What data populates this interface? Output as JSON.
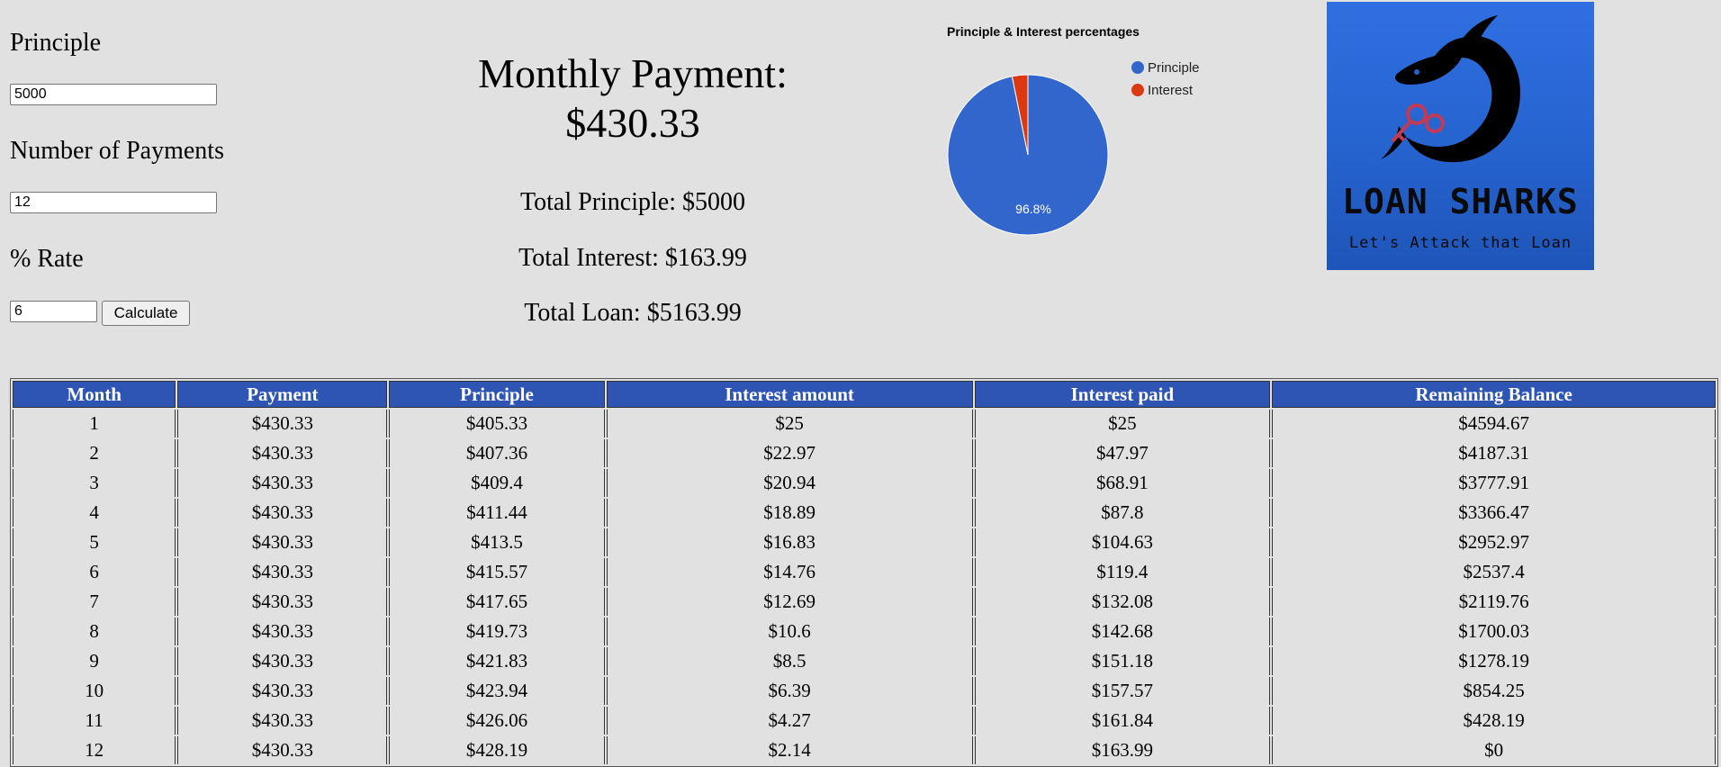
{
  "form": {
    "principle_label": "Principle",
    "principle_value": "5000",
    "payments_label": "Number of Payments",
    "payments_value": "12",
    "rate_label": "% Rate",
    "rate_value": "6",
    "calculate_label": "Calculate"
  },
  "summary": {
    "monthly_label": "Monthly Payment:",
    "monthly_value": "$430.33",
    "total_principle": "Total Principle: $5000",
    "total_interest": "Total Interest: $163.99",
    "total_loan": "Total Loan: $5163.99"
  },
  "chart_data": {
    "type": "pie",
    "title": "Principle & Interest percentages",
    "labels": [
      "Principle",
      "Interest"
    ],
    "values": [
      5000,
      163.99
    ],
    "slice_labels": [
      "96.8%",
      ""
    ],
    "colors": [
      "#3366cc",
      "#dc3912"
    ],
    "legend_position": "right"
  },
  "logo": {
    "title": "LOAN SHARKS",
    "subtitle": "Let's Attack that Loan",
    "colors": {
      "background": "#2563cf",
      "shark": "#000000",
      "key": "#c23a54"
    }
  },
  "table": {
    "headers": [
      "Month",
      "Payment",
      "Principle",
      "Interest amount",
      "Interest paid",
      "Remaining Balance"
    ],
    "rows": [
      [
        "1",
        "$430.33",
        "$405.33",
        "$25",
        "$25",
        "$4594.67"
      ],
      [
        "2",
        "$430.33",
        "$407.36",
        "$22.97",
        "$47.97",
        "$4187.31"
      ],
      [
        "3",
        "$430.33",
        "$409.4",
        "$20.94",
        "$68.91",
        "$3777.91"
      ],
      [
        "4",
        "$430.33",
        "$411.44",
        "$18.89",
        "$87.8",
        "$3366.47"
      ],
      [
        "5",
        "$430.33",
        "$413.5",
        "$16.83",
        "$104.63",
        "$2952.97"
      ],
      [
        "6",
        "$430.33",
        "$415.57",
        "$14.76",
        "$119.4",
        "$2537.4"
      ],
      [
        "7",
        "$430.33",
        "$417.65",
        "$12.69",
        "$132.08",
        "$2119.76"
      ],
      [
        "8",
        "$430.33",
        "$419.73",
        "$10.6",
        "$142.68",
        "$1700.03"
      ],
      [
        "9",
        "$430.33",
        "$421.83",
        "$8.5",
        "$151.18",
        "$1278.19"
      ],
      [
        "10",
        "$430.33",
        "$423.94",
        "$6.39",
        "$157.57",
        "$854.25"
      ],
      [
        "11",
        "$430.33",
        "$426.06",
        "$4.27",
        "$161.84",
        "$428.19"
      ],
      [
        "12",
        "$430.33",
        "$428.19",
        "$2.14",
        "$163.99",
        "$0"
      ]
    ],
    "header_color": "#2e55b4"
  }
}
